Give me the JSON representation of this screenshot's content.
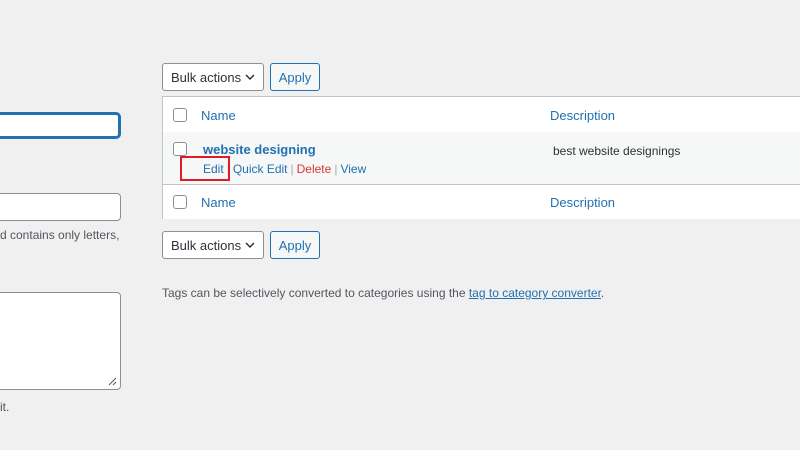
{
  "form": {
    "slug_hint": "d contains only letters,",
    "desc_hint": "it."
  },
  "bulk_top": {
    "select_label": "Bulk actions",
    "apply_label": "Apply"
  },
  "bulk_bottom": {
    "select_label": "Bulk actions",
    "apply_label": "Apply"
  },
  "table": {
    "header": {
      "name": "Name",
      "description": "Description"
    },
    "footer": {
      "name": "Name",
      "description": "Description"
    },
    "rows": [
      {
        "name": "website designing",
        "description": "best website designings",
        "actions": {
          "edit": "Edit",
          "quick_edit": "Quick Edit",
          "delete": "Delete",
          "view": "View"
        }
      }
    ]
  },
  "separators": {
    "pipe": "|"
  },
  "note": {
    "prefix": "Tags can be selectively converted to categories using the ",
    "link": "tag to category converter",
    "suffix": "."
  },
  "colors": {
    "accent": "#2271b1",
    "danger": "#d63638",
    "highlight": "#e01b24",
    "background": "#f0f0f1"
  }
}
